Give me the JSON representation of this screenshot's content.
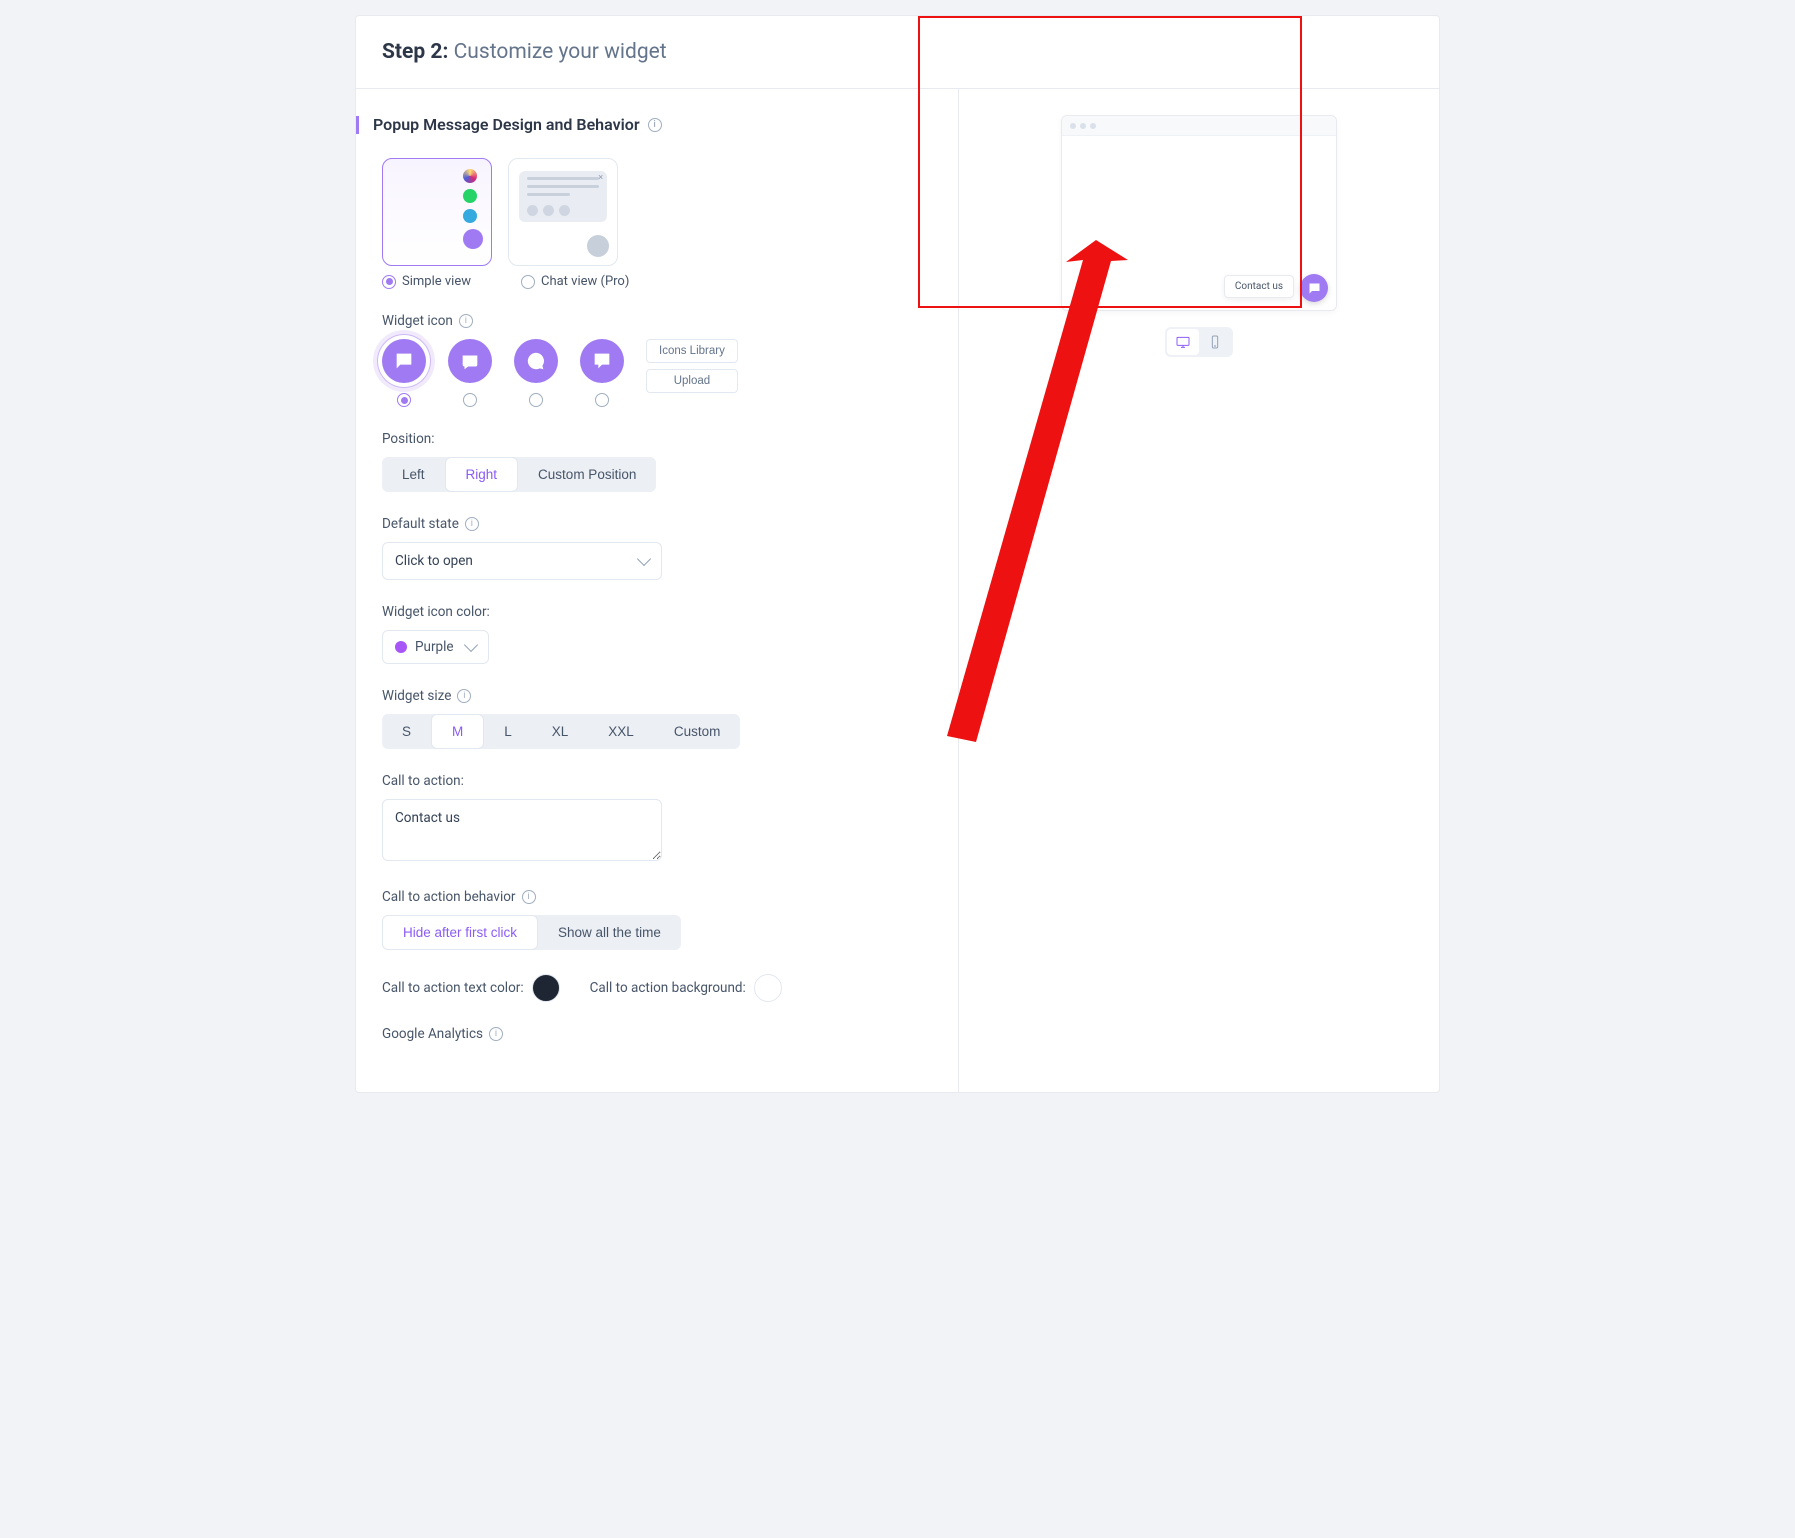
{
  "header": {
    "step": "Step 2:",
    "title": "Customize your widget"
  },
  "section_title": "Popup Message Design and Behavior",
  "design": {
    "simple_label": "Simple view",
    "chat_label": "Chat view (Pro)"
  },
  "widget_icon": {
    "label": "Widget icon",
    "btn_library": "Icons Library",
    "btn_upload": "Upload"
  },
  "position": {
    "label": "Position:",
    "options": [
      "Left",
      "Right",
      "Custom Position"
    ],
    "selected": "Right"
  },
  "default_state": {
    "label": "Default state",
    "value": "Click to open"
  },
  "icon_color": {
    "label": "Widget icon color:",
    "value": "Purple"
  },
  "widget_size": {
    "label": "Widget size",
    "options": [
      "S",
      "M",
      "L",
      "XL",
      "XXL",
      "Custom"
    ],
    "selected": "M"
  },
  "cta": {
    "label": "Call to action:",
    "value": "Contact us"
  },
  "cta_behavior": {
    "label": "Call to action behavior",
    "options": [
      "Hide after first click",
      "Show all the time"
    ],
    "selected": "Hide after first click"
  },
  "cta_text_color_label": "Call to action text color:",
  "cta_bg_label": "Call to action background:",
  "ga_label": "Google Analytics",
  "preview": {
    "cta_text": "Contact us"
  }
}
